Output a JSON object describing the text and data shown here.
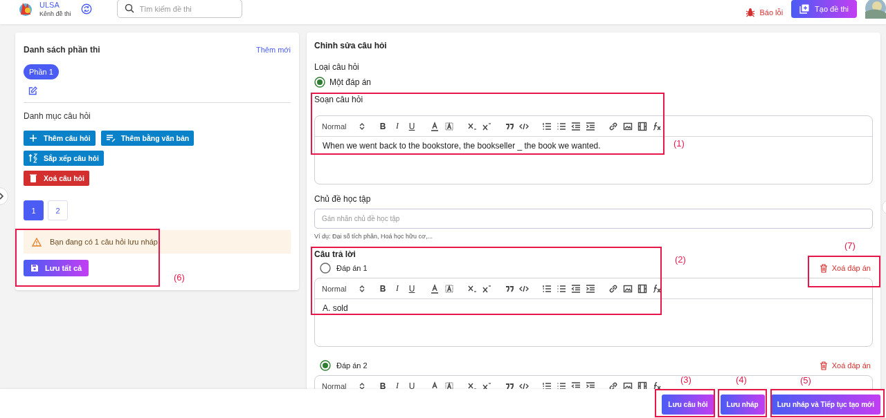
{
  "header": {
    "brand": "ULSA",
    "subtitle": "Kênh đề thi",
    "search": {
      "placeholder": "Tìm kiếm đề thi"
    },
    "report": "Báo lỗi",
    "create": "Tạo đề thi"
  },
  "sections_panel": {
    "title": "Danh sách phần thi",
    "add": "Thêm mới",
    "parts": [
      {
        "label": "Phần 1",
        "selected": true
      }
    ],
    "category_title": "Danh mục câu hỏi",
    "actions": [
      {
        "label": "Thêm câu hỏi",
        "kind": "add"
      },
      {
        "label": "Thêm bằng văn bản",
        "kind": "text"
      },
      {
        "label": "Sắp xếp câu hỏi",
        "kind": "sort"
      },
      {
        "label": "Xoá câu hỏi",
        "kind": "delete"
      }
    ],
    "pages": [
      {
        "label": "1",
        "selected": true
      },
      {
        "label": "2",
        "selected": false
      }
    ],
    "alert": "Bạn đang có 1 câu hỏi lưu nháp",
    "save_all": "Lưu tất cả"
  },
  "editor": {
    "title": "Chinh sửa câu hỏi",
    "type_label": "Loại câu hỏi",
    "types": [
      {
        "label": "Một đáp án",
        "selected": true
      }
    ],
    "compose_label": "Soạn câu hỏi",
    "question_editor": {
      "format": "Normal",
      "marks": [
        "B",
        "I",
        "U"
      ],
      "content": "When we went back to the bookstore, the bookseller _ the book we wanted."
    },
    "topic_label": "Chủ đề học tập",
    "topic": {
      "placeholder": "Gán nhãn chủ đề học tập"
    },
    "topic_hint": "Ví dụ: Đại số tích phân, Hoá học hữu cơ,...",
    "answers_label": "Câu trả lời",
    "answers": [
      {
        "label": "Đáp án 1",
        "selected": false,
        "delete": "Xoá đáp án",
        "editor": {
          "format": "Normal",
          "marks": [
            "B",
            "I",
            "U"
          ],
          "content": "A. sold"
        }
      },
      {
        "label": "Đáp án 2",
        "selected": true,
        "delete": "Xoá đáp án",
        "editor": {
          "format": "Normal",
          "marks": [
            "B",
            "I",
            "U"
          ]
        }
      }
    ]
  },
  "footer": {
    "buttons": [
      "Lưu câu hỏi",
      "Lưu nháp",
      "Lưu nháp và Tiếp tục tạo mới"
    ]
  },
  "annotations": [
    {
      "label": "(1)"
    },
    {
      "label": "(2)"
    },
    {
      "label": "(3)"
    },
    {
      "label": "(4)"
    },
    {
      "label": "(5)"
    },
    {
      "label": "(6)"
    },
    {
      "label": "(7)"
    }
  ]
}
